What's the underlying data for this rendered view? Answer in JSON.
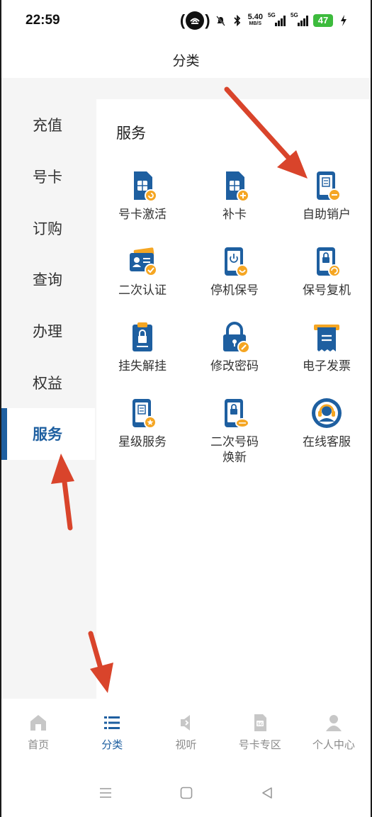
{
  "status_bar": {
    "time": "22:59",
    "net_speed": "5.40",
    "net_speed_unit": "MB/S",
    "signal_label_1": "5G",
    "signal_label_2": "5G",
    "battery": "47"
  },
  "header": {
    "title": "分类"
  },
  "sidebar": {
    "items": [
      {
        "label": "充值"
      },
      {
        "label": "号卡"
      },
      {
        "label": "订购"
      },
      {
        "label": "查询"
      },
      {
        "label": "办理"
      },
      {
        "label": "权益"
      },
      {
        "label": "服务"
      }
    ],
    "active_index": 6
  },
  "panel": {
    "title": "服务",
    "services": [
      {
        "label": "号卡激活",
        "icon": "sim-activate-icon"
      },
      {
        "label": "补卡",
        "icon": "sim-add-icon"
      },
      {
        "label": "自助销户",
        "icon": "phone-cancel-icon"
      },
      {
        "label": "二次认证",
        "icon": "id-verify-icon"
      },
      {
        "label": "停机保号",
        "icon": "phone-suspend-icon"
      },
      {
        "label": "保号复机",
        "icon": "phone-restore-icon"
      },
      {
        "label": "挂失解挂",
        "icon": "clipboard-lock-icon"
      },
      {
        "label": "修改密码",
        "icon": "lock-edit-icon"
      },
      {
        "label": "电子发票",
        "icon": "invoice-icon"
      },
      {
        "label": "星级服务",
        "icon": "phone-star-icon"
      },
      {
        "label": "二次号码焕新",
        "label_line1": "二次号码",
        "label_line2": "焕新",
        "icon": "phone-lock-renew-icon"
      },
      {
        "label": "在线客服",
        "icon": "headset-icon"
      }
    ]
  },
  "tabbar": {
    "tabs": [
      {
        "label": "首页",
        "icon": "home-icon"
      },
      {
        "label": "分类",
        "icon": "list-icon"
      },
      {
        "label": "视听",
        "icon": "speaker-icon"
      },
      {
        "label": "号卡专区",
        "icon": "sim-card-icon"
      },
      {
        "label": "个人中心",
        "icon": "person-icon"
      }
    ],
    "active_index": 1
  },
  "colors": {
    "primary": "#1e5fa0",
    "accent": "#f5a623",
    "annotation_arrow": "#d9442b"
  }
}
